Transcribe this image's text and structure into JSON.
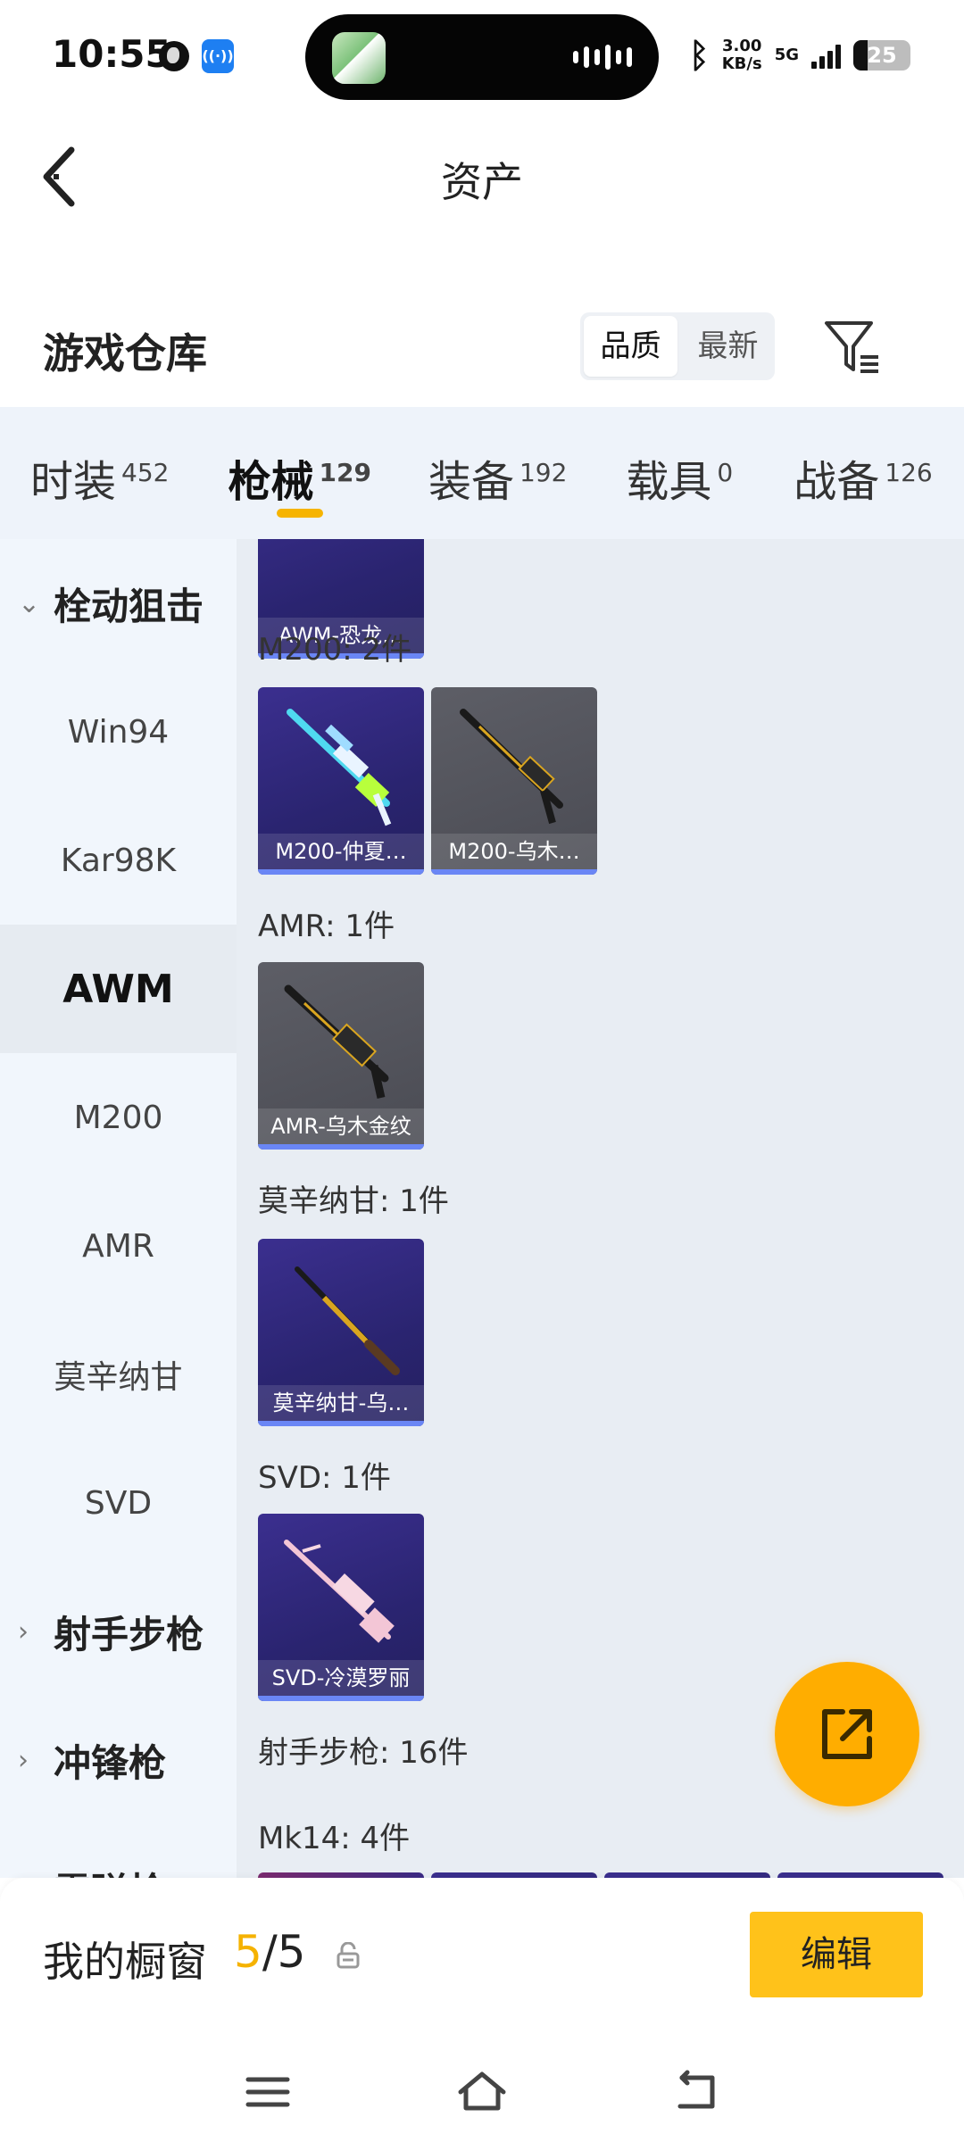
{
  "status_bar": {
    "time": "10:55",
    "speed_value": "3.00",
    "speed_unit": "KB/s",
    "network": "5G",
    "battery": "25"
  },
  "header": {
    "title": "资产"
  },
  "warehouse": {
    "title": "游戏仓库",
    "sort_options": [
      "品质",
      "最新"
    ],
    "active_sort": "品质"
  },
  "tabs": [
    {
      "label": "时装",
      "count": "452"
    },
    {
      "label": "枪械",
      "count": "129"
    },
    {
      "label": "装备",
      "count": "192"
    },
    {
      "label": "载具",
      "count": "0"
    },
    {
      "label": "战备",
      "count": "126"
    }
  ],
  "active_tab": "枪械",
  "sidebar": {
    "items": [
      {
        "label": "栓动狙击",
        "type": "group",
        "chevron": "⌄"
      },
      {
        "label": "Win94",
        "type": "item"
      },
      {
        "label": "Kar98K",
        "type": "item"
      },
      {
        "label": "AWM",
        "type": "item",
        "active": true
      },
      {
        "label": "M200",
        "type": "item"
      },
      {
        "label": "AMR",
        "type": "item"
      },
      {
        "label": "莫辛纳甘",
        "type": "item"
      },
      {
        "label": "SVD",
        "type": "item"
      },
      {
        "label": "射手步枪",
        "type": "group",
        "chevron": "›"
      },
      {
        "label": "冲锋枪",
        "type": "group",
        "chevron": "›"
      },
      {
        "label": "霰弹枪",
        "type": "group",
        "chevron": "›"
      }
    ]
  },
  "main": {
    "partial_card": {
      "caption": "AWM-恐龙…"
    },
    "groups": [
      {
        "label": "M200: 2件",
        "cards": [
          {
            "caption": "M200-仲夏…",
            "style": "purple"
          },
          {
            "caption": "M200-乌木…",
            "style": "gray"
          }
        ]
      },
      {
        "label": "AMR: 1件",
        "cards": [
          {
            "caption": "AMR-乌木金纹",
            "style": "gray"
          }
        ]
      },
      {
        "label": "莫辛纳甘: 1件",
        "cards": [
          {
            "caption": "莫辛纳甘-乌…",
            "style": "purple"
          }
        ]
      },
      {
        "label": "SVD: 1件",
        "cards": [
          {
            "caption": "SVD-冷漠罗丽",
            "style": "purple"
          }
        ]
      }
    ],
    "section_label": "射手步枪: 16件",
    "sub_label": "Mk14: 4件"
  },
  "showcase": {
    "label": "我的橱窗",
    "current": "5",
    "separator": "/",
    "max": "5",
    "edit_label": "编辑"
  },
  "colors": {
    "accent": "#ffad00",
    "tab_underline": "#f6b400",
    "card_edge": "#6a86f5"
  }
}
